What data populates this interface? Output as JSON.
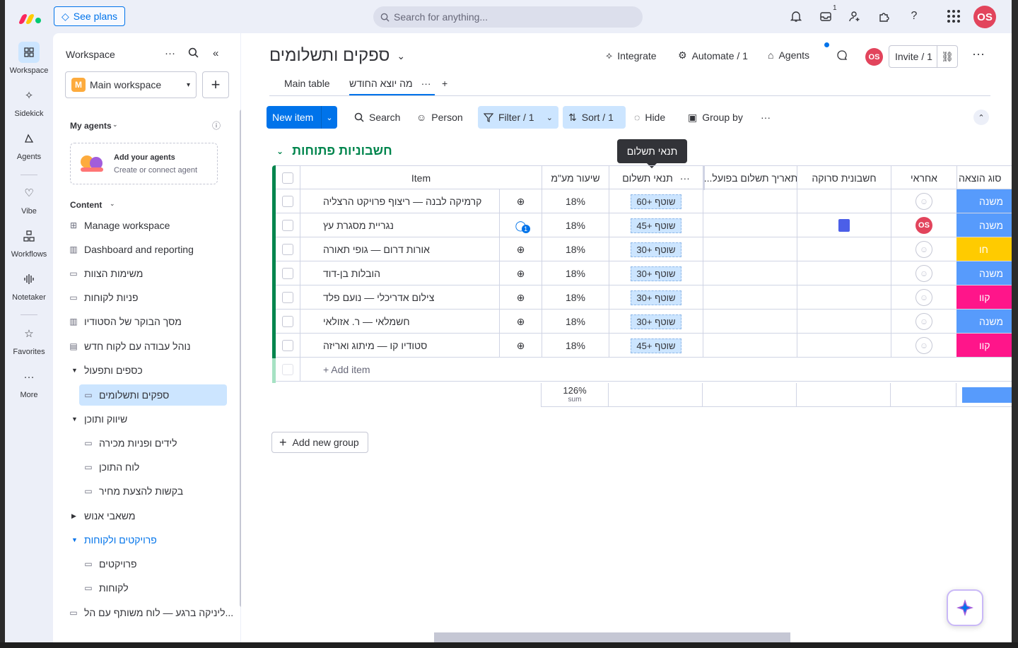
{
  "topbar": {
    "see_plans": "See plans",
    "search_placeholder": "Search for anything...",
    "inbox_badge": "1",
    "avatar": "OS"
  },
  "rail": {
    "items": [
      {
        "label": "Workspace",
        "icon": "grid-icon"
      },
      {
        "label": "Sidekick",
        "icon": "sparkle-icon"
      },
      {
        "label": "Agents",
        "icon": "agent-icon"
      },
      {
        "label": "Vibe",
        "icon": "heart-icon"
      },
      {
        "label": "Workflows",
        "icon": "workflow-icon"
      },
      {
        "label": "Notetaker",
        "icon": "waveform-icon"
      },
      {
        "label": "Favorites",
        "icon": "star-icon"
      },
      {
        "label": "More",
        "icon": "more-icon"
      }
    ]
  },
  "sidebar": {
    "title": "Workspace",
    "workspace_name": "Main workspace",
    "workspace_initial": "M",
    "my_agents_label": "My agents",
    "agents_card_title": "Add your agents",
    "agents_card_sub": "Create or connect agent",
    "content_label": "Content",
    "items": [
      {
        "label": "Manage workspace"
      },
      {
        "label": "Dashboard and reporting"
      },
      {
        "label": "משימות הצוות"
      },
      {
        "label": "פניות לקוחות"
      },
      {
        "label": "מסך הבוקר של הסטודיו"
      },
      {
        "label": "נוהל עבודה עם לקוח חדש"
      },
      {
        "label": "כספים ותפעול"
      },
      {
        "label": "ספקים ותשלומים"
      },
      {
        "label": "שיווק ותוכן"
      },
      {
        "label": "לידים ופניות מכירה"
      },
      {
        "label": "לוח התוכן"
      },
      {
        "label": "בקשות להצעת מחיר"
      },
      {
        "label": "משאבי אנוש"
      },
      {
        "label": "פרויקטים ולקוחות"
      },
      {
        "label": "פרויקטים"
      },
      {
        "label": "לקוחות"
      },
      {
        "label": "ליניקה ברגע — לוח משותף עם הל..."
      }
    ]
  },
  "board": {
    "title": "ספקים ותשלומים",
    "actions": {
      "integrate": "Integrate",
      "automate": "Automate / 1",
      "agents": "Agents",
      "invite": "Invite / 1"
    },
    "tabs": [
      {
        "label": "Main table"
      },
      {
        "label": "מה יוצא החודש"
      }
    ],
    "toolbar": {
      "new_item": "New item",
      "search": "Search",
      "person": "Person",
      "filter": "Filter / 1",
      "sort": "Sort / 1",
      "hide": "Hide",
      "group_by": "Group by"
    },
    "tooltip": "תנאי תשלום",
    "group": {
      "title": "חשבוניות פתוחות",
      "color": "#00854d",
      "columns": {
        "item": "Item",
        "vat": "שיעור מע\"מ",
        "terms": "תנאי תשלום",
        "paid_date": "...תאריך תשלום בפועל",
        "invoice": "חשבונית סרוקה",
        "owner": "אחראי",
        "expense": "סוג הוצאה"
      },
      "rows": [
        {
          "name": "קרמיקה לבנה — ריצוף פרויקט הרצליה",
          "vat": "18%",
          "terms": "שוטף +60",
          "owner": "",
          "expense": "משנה",
          "expense_color": "#579bfc",
          "updates": ""
        },
        {
          "name": "נגריית מסגרת עץ",
          "vat": "18%",
          "terms": "שוטף +45",
          "owner": "OS",
          "expense": "משנה",
          "expense_color": "#579bfc",
          "updates": "1",
          "has_file": true
        },
        {
          "name": "אורות דרום — גופי תאורה",
          "vat": "18%",
          "terms": "שוטף +30",
          "owner": "",
          "expense": "חו",
          "expense_color": "#ffcb00",
          "updates": ""
        },
        {
          "name": "הובלות בן-דוד",
          "vat": "18%",
          "terms": "שוטף +30",
          "owner": "",
          "expense": "משנה",
          "expense_color": "#579bfc",
          "updates": ""
        },
        {
          "name": "צילום אדריכלי — נועם פלד",
          "vat": "18%",
          "terms": "שוטף +30",
          "owner": "",
          "expense": "קוו",
          "expense_color": "#ff158a",
          "updates": ""
        },
        {
          "name": "חשמלאי — ר. אזולאי",
          "vat": "18%",
          "terms": "שוטף +30",
          "owner": "",
          "expense": "משנה",
          "expense_color": "#579bfc",
          "updates": ""
        },
        {
          "name": "סטודיו קו — מיתוג ואריזה",
          "vat": "18%",
          "terms": "שוטף +45",
          "owner": "",
          "expense": "קוו",
          "expense_color": "#ff158a",
          "updates": ""
        }
      ],
      "add_item": "+ Add item",
      "sum_value": "126%",
      "sum_label": "sum"
    },
    "add_group": "Add new group"
  }
}
